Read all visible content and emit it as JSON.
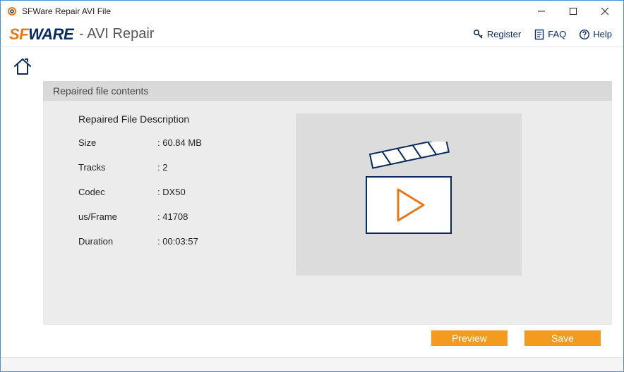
{
  "titlebar": {
    "title": "SFWare Repair AVI File"
  },
  "brand": {
    "sf": "SF",
    "ware": "WARE",
    "suffix": "- AVI Repair",
    "register": "Register",
    "faq": "FAQ",
    "help": "Help"
  },
  "panel": {
    "header": "Repaired file contents",
    "desc_title": "Repaired File Description",
    "rows": {
      "size_label": "Size",
      "size_value": "60.84 MB",
      "tracks_label": "Tracks",
      "tracks_value": "2",
      "codec_label": "Codec",
      "codec_value": "DX50",
      "usframe_label": "us/Frame",
      "usframe_value": "41708",
      "duration_label": "Duration",
      "duration_value": "00:03:57"
    }
  },
  "buttons": {
    "preview": "Preview",
    "save": "Save"
  }
}
